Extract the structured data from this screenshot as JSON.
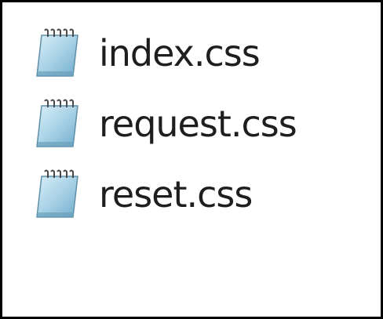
{
  "files": [
    {
      "name": "index.css",
      "icon": "notepad-document-icon"
    },
    {
      "name": "request.css",
      "icon": "notepad-document-icon"
    },
    {
      "name": "reset.css",
      "icon": "notepad-document-icon"
    }
  ],
  "colors": {
    "border": "#000000",
    "text": "#1e1e1e",
    "icon_blue": "#8fc3dc",
    "icon_blue_dark": "#5d9dbf"
  }
}
